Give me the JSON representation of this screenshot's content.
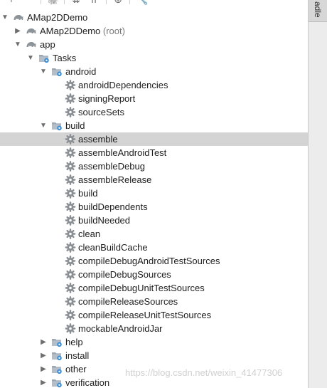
{
  "toolbar": {
    "buttons": [
      {
        "icon": "add-icon",
        "glyph": "+"
      },
      {
        "icon": "remove-icon",
        "glyph": "−"
      },
      {
        "icon": "elephant-icon",
        "glyph": "🐘"
      },
      {
        "icon": "expand-all-icon",
        "glyph": "⇊"
      },
      {
        "icon": "collapse-all-icon",
        "glyph": "⇈"
      },
      {
        "icon": "link-icon",
        "glyph": "⊕"
      },
      {
        "icon": "wrench-icon",
        "glyph": "🔧"
      }
    ]
  },
  "right_strip": {
    "tab_label": "adle"
  },
  "tree": {
    "root": {
      "label": "AMap2DDemo",
      "expanded": true
    },
    "root_project": {
      "label": "AMap2DDemo",
      "suffix": "(root)",
      "expanded": false
    },
    "app": {
      "label": "app",
      "expanded": true
    },
    "tasks": {
      "label": "Tasks",
      "expanded": true
    },
    "android_group": {
      "label": "android",
      "expanded": true,
      "tasks": [
        "androidDependencies",
        "signingReport",
        "sourceSets"
      ]
    },
    "build_group": {
      "label": "build",
      "expanded": true,
      "selected_task": "assemble",
      "tasks": [
        "assemble",
        "assembleAndroidTest",
        "assembleDebug",
        "assembleRelease",
        "build",
        "buildDependents",
        "buildNeeded",
        "clean",
        "cleanBuildCache",
        "compileDebugAndroidTestSources",
        "compileDebugSources",
        "compileDebugUnitTestSources",
        "compileReleaseSources",
        "compileReleaseUnitTestSources",
        "mockableAndroidJar"
      ]
    },
    "collapsed_groups": [
      {
        "label": "help"
      },
      {
        "label": "install"
      },
      {
        "label": "other"
      },
      {
        "label": "verification"
      }
    ]
  },
  "colors": {
    "selection": "#d4d4d4",
    "gear": "#8a8f94",
    "folder": "#9aa7b4",
    "accent_blue": "#3d8fd6",
    "gradle_gray": "#8d9499"
  },
  "watermark": "https://blog.csdn.net/weixin_41477306"
}
